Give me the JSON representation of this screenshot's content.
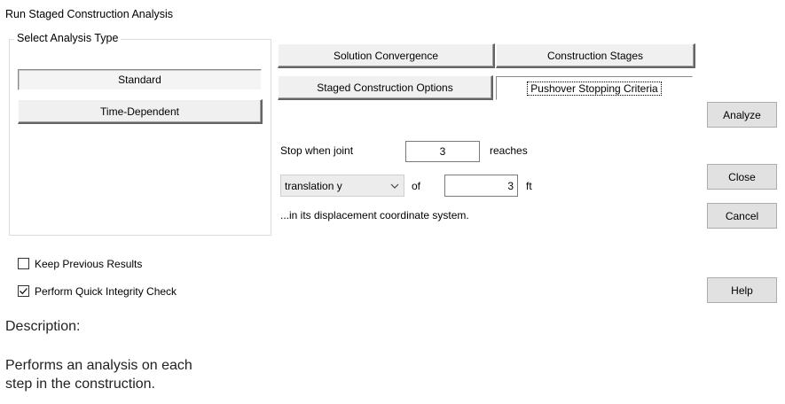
{
  "window": {
    "title": "Run Staged Construction Analysis"
  },
  "analysis_type": {
    "group_label": "Select Analysis Type",
    "options": [
      {
        "label": "Standard",
        "state": "pressed"
      },
      {
        "label": "Time-Dependent",
        "state": "raised"
      }
    ]
  },
  "tabs": [
    {
      "label": "Solution Convergence"
    },
    {
      "label": "Construction Stages"
    },
    {
      "label": "Staged Construction Options"
    },
    {
      "label": "Pushover Stopping Criteria",
      "active": true
    }
  ],
  "stopping": {
    "stop_label": "Stop when joint",
    "joint_value": "3",
    "reaches_label": "reaches",
    "dof_selected": "translation y",
    "of_label": "of",
    "value": "3",
    "unit": "ft",
    "note": "...in its displacement coordinate system."
  },
  "side_buttons": {
    "analyze": "Analyze",
    "close": "Close",
    "cancel": "Cancel",
    "help": "Help"
  },
  "options": {
    "keep_previous": {
      "label": "Keep Previous Results",
      "checked": false
    },
    "quick_integrity": {
      "label": "Perform Quick Integrity Check",
      "checked": true
    }
  },
  "description": {
    "heading": "Description:",
    "line1": "Performs an analysis on each",
    "line2": "step in the construction."
  }
}
